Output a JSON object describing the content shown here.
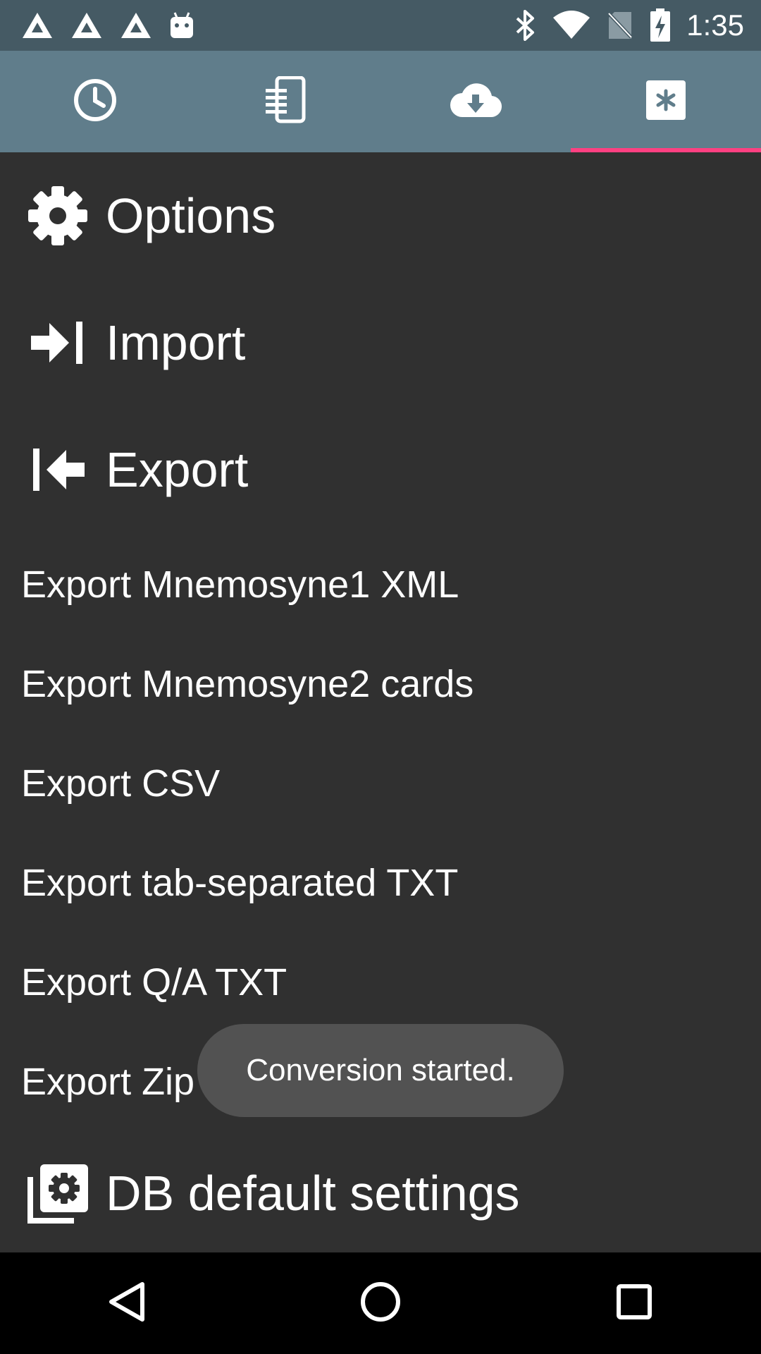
{
  "status_bar": {
    "time": "1:35",
    "left_icons": [
      "triangle-notification-icon",
      "triangle-notification-icon",
      "triangle-notification-icon",
      "android-icon"
    ],
    "right_icons": [
      "bluetooth-icon",
      "wifi-icon",
      "no-sim-icon",
      "battery-charging-icon"
    ]
  },
  "tabs": [
    {
      "icon": "clock-icon",
      "active": false
    },
    {
      "icon": "card-list-icon",
      "active": false
    },
    {
      "icon": "cloud-download-icon",
      "active": false
    },
    {
      "icon": "asterisk-icon",
      "active": true
    }
  ],
  "menu": {
    "options": {
      "label": "Options",
      "icon": "gear-icon"
    },
    "import": {
      "label": "Import",
      "icon": "import-icon"
    },
    "export": {
      "label": "Export",
      "icon": "export-icon"
    },
    "export_items": [
      {
        "label": "Export Mnemosyne1 XML"
      },
      {
        "label": "Export Mnemosyne2 cards"
      },
      {
        "label": "Export CSV"
      },
      {
        "label": "Export tab-separated TXT"
      },
      {
        "label": "Export Q/A TXT"
      },
      {
        "label": "Export Zip"
      }
    ],
    "db_settings": {
      "label": "DB default settings",
      "icon": "db-settings-icon"
    }
  },
  "toast": {
    "message": "Conversion started."
  },
  "colors": {
    "status_bar": "#455a64",
    "tab_bar": "#607d8b",
    "accent": "#ff4081",
    "background": "#303030",
    "toast": "#525252"
  },
  "nav_bar": [
    "back-icon",
    "home-icon",
    "recents-icon"
  ]
}
